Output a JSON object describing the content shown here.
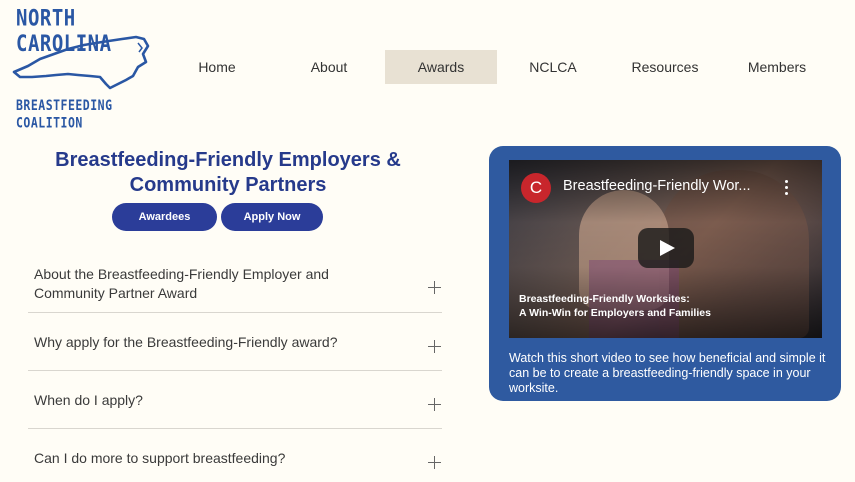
{
  "logo": {
    "top_text": "NORTH CAROLINA",
    "bottom_text": "BREASTFEEDING COALITION"
  },
  "nav": {
    "items": [
      {
        "label": "Home"
      },
      {
        "label": "About"
      },
      {
        "label": "Awards",
        "active": true
      },
      {
        "label": "NCLCA"
      },
      {
        "label": "Resources"
      },
      {
        "label": "Members"
      }
    ]
  },
  "main": {
    "heading_line1": "Breastfeeding-Friendly Employers &",
    "heading_line2": "Community Partners",
    "buttons": {
      "awardees": "Awardees",
      "apply": "Apply Now"
    },
    "faq": [
      {
        "line1": "About the Breastfeeding-Friendly Employer and",
        "line2": "Community Partner Award"
      },
      {
        "line1": "Why apply for the Breastfeeding-Friendly award?"
      },
      {
        "line1": "When do I apply?"
      },
      {
        "line1": "Can I do more to support breastfeeding?"
      }
    ]
  },
  "video_card": {
    "channel_letter": "C",
    "video_title": "Breastfeeding-Friendly Wor...",
    "overlay_line1": "Breastfeeding-Friendly Worksites:",
    "overlay_line2": "A Win-Win for Employers and Families",
    "caption": "Watch this short video to see how beneficial and simple it can be to create a breastfeeding-friendly space in your worksite."
  },
  "colors": {
    "heading": "#263a8b",
    "pill": "#2b3d99",
    "card": "#2f5aa0",
    "nav_active": "#e8e1d3",
    "logo": "#2a57a4"
  }
}
